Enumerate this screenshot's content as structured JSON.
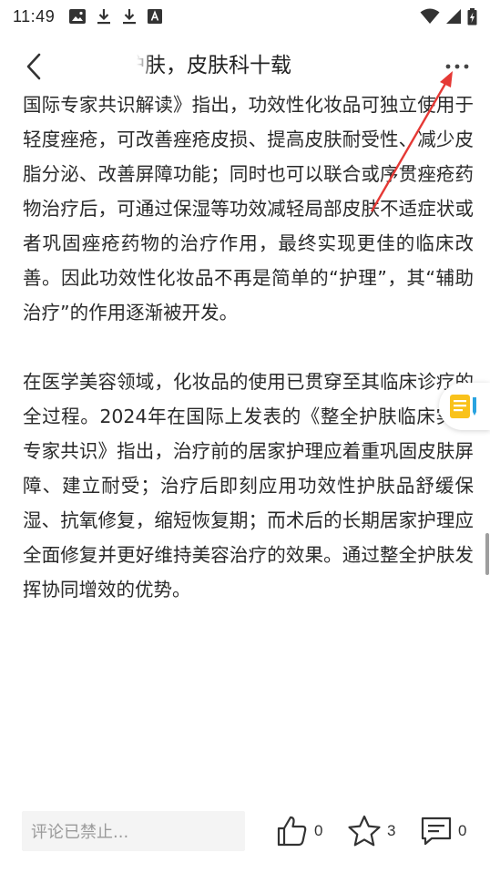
{
  "status_bar": {
    "time": "11:49",
    "left_icons": [
      "image-icon",
      "download-icon",
      "download-icon",
      "a-box-icon"
    ],
    "right_icons": [
      "wifi-icon",
      "signal-icon",
      "battery-icon"
    ]
  },
  "header": {
    "title": "护肤，皮肤科十载",
    "back_icon": "chevron-left-icon",
    "more_icon": "more-horizontal-icon"
  },
  "article": {
    "paragraph_1": "国际专家共识解读》指出，功效性化妆品可独立使用于轻度痤疮，可改善痤疮皮损、提高皮肤耐受性、减少皮脂分泌、改善屏障功能；同时也可以联合或序贯痤疮药物治疗后，可通过保湿等功效减轻局部皮肤不适症状或者巩固痤疮药物的治疗作用，最终实现更佳的临床改善。因此功效性化妆品不再是简单的“护理”，其“辅助治疗”的作用逐渐被开发。",
    "paragraph_2": "在医学美容领域，化妆品的使用已贯穿至其临床诊疗的全过程。2024年在国际上发表的《整全护肤临床实践专家共识》指出，治疗前的居家护理应着重巩固皮肤屏障、建立耐受；治疗后即刻应用功效性护肤品舒缓保湿、抗氧修复，缩短恢复期；而术后的长期居家护理应全面修复并更好维持美容治疗的效果。通过整全护肤发挥协同增效的优势。"
  },
  "floating_button_icon": "notes-icon",
  "bottom_bar": {
    "comment_placeholder": "评论已禁止...",
    "like_count": "0",
    "favorite_count": "3",
    "comment_count": "0"
  },
  "colors": {
    "annotation_arrow": "#e53935",
    "note_icon_yellow": "#f9c21b",
    "note_icon_blue": "#29a3e0"
  }
}
